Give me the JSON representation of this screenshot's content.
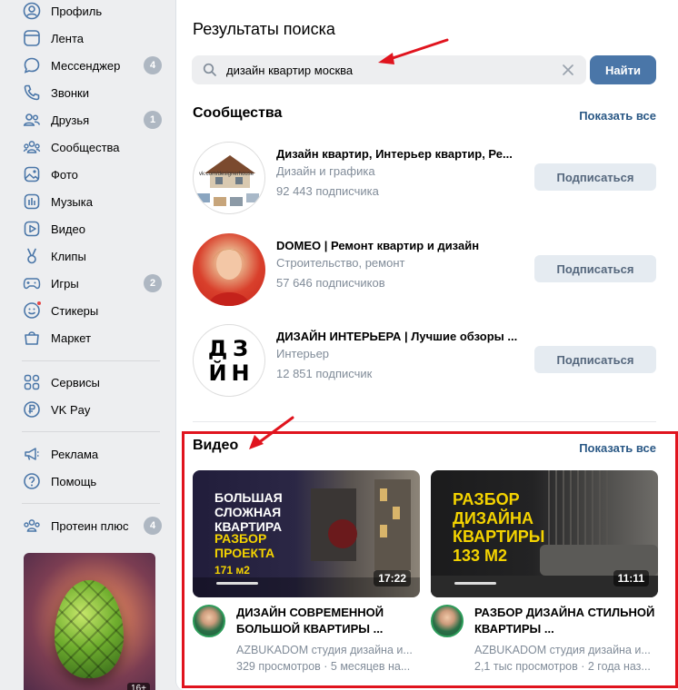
{
  "sidebar": {
    "items": [
      {
        "icon": "profile-icon",
        "label": "Профиль"
      },
      {
        "icon": "feed-icon",
        "label": "Лента"
      },
      {
        "icon": "messenger-icon",
        "label": "Мессенджер",
        "badge": "4"
      },
      {
        "icon": "phone-icon",
        "label": "Звонки"
      },
      {
        "icon": "friends-icon",
        "label": "Друзья",
        "badge": "1"
      },
      {
        "icon": "communities-icon",
        "label": "Сообщества"
      },
      {
        "icon": "photo-icon",
        "label": "Фото"
      },
      {
        "icon": "music-icon",
        "label": "Музыка"
      },
      {
        "icon": "video-icon",
        "label": "Видео"
      },
      {
        "icon": "clips-icon",
        "label": "Клипы"
      },
      {
        "icon": "games-icon",
        "label": "Игры",
        "badge": "2"
      },
      {
        "icon": "stickers-icon",
        "label": "Стикеры"
      },
      {
        "icon": "market-icon",
        "label": "Маркет"
      },
      {
        "icon": "services-icon",
        "label": "Сервисы"
      },
      {
        "icon": "vkpay-icon",
        "label": "VK Pay"
      },
      {
        "icon": "ads-icon",
        "label": "Реклама"
      },
      {
        "icon": "help-icon",
        "label": "Помощь"
      },
      {
        "icon": "group-icon",
        "label": "Протеин плюс",
        "badge": "4"
      }
    ],
    "ad_badge": "16+"
  },
  "search": {
    "title": "Результаты поиска",
    "query": "дизайн квартир москва",
    "button": "Найти"
  },
  "communities": {
    "title": "Сообщества",
    "show_all": "Показать все",
    "subscribe_label": "Подписаться",
    "items": [
      {
        "name": "Дизайн квартир, Интерьер квартир, Ре...",
        "category": "Дизайн и графика",
        "subscribers": "92 443 подписчика",
        "avatar_text": "vk.com/designerhouse"
      },
      {
        "name": "DOMEO | Ремонт квартир и дизайн",
        "category": "Строительство, ремонт",
        "subscribers": "57 646 подписчиков"
      },
      {
        "name": "ДИЗАЙН ИНТЕРЬЕРА | Лучшие обзоры ...",
        "category": "Интерьер",
        "subscribers": "12 851 подписчик",
        "avatar_letters": [
          "Д",
          "З",
          "Й",
          "Н"
        ]
      }
    ]
  },
  "videos": {
    "title": "Видео",
    "show_all": "Показать все",
    "items": [
      {
        "thumb_white": "БОЛЬШАЯ\nСЛОЖНАЯ\nКВАРТИРА",
        "thumb_yellow": "РАЗБОР\nПРОЕКТА",
        "thumb_small": "171 м2",
        "duration": "17:22",
        "title": "ДИЗАЙН СОВРЕМЕННОЙ БОЛЬШОЙ КВАРТИРЫ ...",
        "channel": "AZBUKADOM студия дизайна и...",
        "meta": "329 просмотров · 5 месяцев на..."
      },
      {
        "thumb_yellow": "РАЗБОР\nДИЗАЙНА\nКВАРТИРЫ\n133 М2",
        "duration": "11:11",
        "title": "РАЗБОР ДИЗАЙНА СТИЛЬНОЙ КВАРТИРЫ ...",
        "channel": "AZBUKADOM студия дизайна и...",
        "meta": "2,1 тыс просмотров · 2 года наз..."
      }
    ]
  },
  "colors": {
    "accent": "#4a76a8",
    "link": "#2a5885",
    "highlight_frame": "#e0141e",
    "badge": "#aeb7c2"
  }
}
